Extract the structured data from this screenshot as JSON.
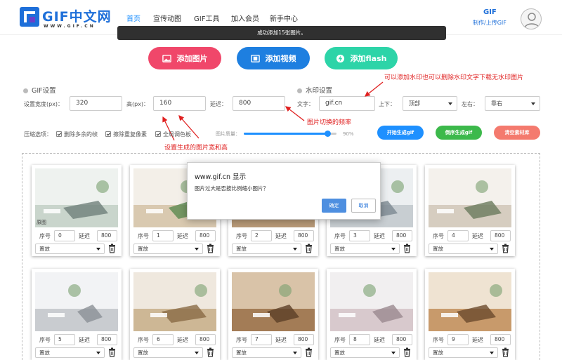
{
  "header": {
    "logo_text": "GIF中文网",
    "logo_sub": "WWW.GIF.CN",
    "nav": [
      "首页",
      "宣传动图",
      "GIF工具",
      "加入会员",
      "新手中心"
    ],
    "gif_link": "GIF",
    "upload_link": "制作/上传GIF"
  },
  "toast": "成功添加15张图片。",
  "buttons": {
    "add_image": "添加图片",
    "add_video": "添加视频",
    "add_flash": "添加flash"
  },
  "gif_settings": {
    "title": "GIF设置",
    "width_label": "设置宽度(px)：",
    "width_value": "320",
    "height_label": "高(px)：",
    "height_value": "160",
    "delay_label": "延迟：",
    "delay_value": "800"
  },
  "watermark": {
    "title": "水印设置",
    "text_label": "文字：",
    "text_value": "gif.cn",
    "vertical_label": "上下：",
    "vertical_value": "顶部",
    "horizontal_label": "左右：",
    "horizontal_value": "靠右"
  },
  "compress": {
    "label": "压缩选项：",
    "options": [
      "删除多余的帧",
      "擦除重复像素",
      "全局调色板"
    ],
    "quality_label": "图片质量：",
    "quality_value": "90%",
    "quality_fraction": 0.9
  },
  "actions": {
    "start": "开始生成gif",
    "reverse": "倒序生成gif",
    "clear": "清空素材库"
  },
  "annotations": {
    "watermark_note": "可以添加水印也可以删除水印文字下载无水印图片",
    "frequency_note": "图片切换的频率",
    "size_note": "设置生成的图片宽和高"
  },
  "card_labels": {
    "order": "序号",
    "delay": "延迟",
    "mode": "置放",
    "original": "原图"
  },
  "cards": [
    {
      "order": "0",
      "delay": "800"
    },
    {
      "order": "1",
      "delay": "800"
    },
    {
      "order": "2",
      "delay": "800"
    },
    {
      "order": "3",
      "delay": "800"
    },
    {
      "order": "4",
      "delay": "800"
    },
    {
      "order": "5",
      "delay": "800"
    },
    {
      "order": "6",
      "delay": "800"
    },
    {
      "order": "7",
      "delay": "800"
    },
    {
      "order": "8",
      "delay": "800"
    },
    {
      "order": "9",
      "delay": "800"
    }
  ],
  "dialog": {
    "title": "www.gif.cn 显示",
    "message": "图片过大是否按比例缩小图片？",
    "ok": "确定",
    "cancel": "取消"
  },
  "colors": {
    "accent": "#1e90ff",
    "add_image": "#f0476a",
    "add_video": "#1e7fe0",
    "add_flash": "#2dd4a8",
    "start": "#1e90ff",
    "reverse": "#3cb94b",
    "clear": "#f47a6e",
    "annotation": "#e02020"
  }
}
